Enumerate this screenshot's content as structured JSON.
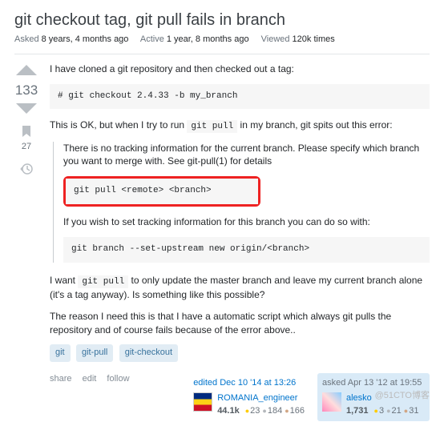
{
  "title": "git checkout tag, git pull fails in branch",
  "meta": {
    "asked_k": "Asked",
    "asked_v": "8 years, 4 months ago",
    "active_k": "Active",
    "active_v": "1 year, 8 months ago",
    "viewed_k": "Viewed",
    "viewed_v": "120k times"
  },
  "vote": {
    "score": "133",
    "bookmark_count": "27"
  },
  "body": {
    "p1": "I have cloned a git repository and then checked out a tag:",
    "code1": "# git checkout 2.4.33 -b my_branch",
    "p2_a": "This is OK, but when I try to run ",
    "p2_code": "git pull",
    "p2_b": " in my branch, git spits out this error:",
    "quote": {
      "q1": "There is no tracking information for the current branch. Please specify which branch you want to merge with. See git-pull(1) for details",
      "qcode1": "git pull <remote> <branch>",
      "q2": "If you wish to set tracking information for this branch you can do so with:",
      "qcode2": "git branch --set-upstream new origin/<branch>"
    },
    "p3_a": "I want ",
    "p3_code": "git pull",
    "p3_b": " to only update the master branch and leave my current branch alone (it's a tag anyway). Is something like this possible?",
    "p4": "The reason I need this is that I have a automatic script which always git pulls the repository and of course fails because of the error above.."
  },
  "tags": [
    "git",
    "git-pull",
    "git-checkout"
  ],
  "actions": {
    "share": "share",
    "edit": "edit",
    "follow": "follow"
  },
  "editor": {
    "label": "edited Dec 10 '14 at 13:26",
    "name": "ROMANIA_engineer",
    "rep": "44.1k",
    "gold": "23",
    "silver": "184",
    "bronze": "166"
  },
  "asker": {
    "label": "asked Apr 13 '12 at 19:55",
    "name": "alesko",
    "rep": "1,731",
    "gold": "3",
    "silver": "21",
    "bronze": "31"
  },
  "watermark": "@51CTO博客"
}
